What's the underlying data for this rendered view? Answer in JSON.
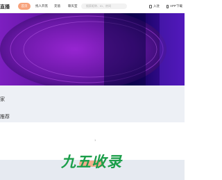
{
  "header": {
    "logo_text": "直播",
    "nav": {
      "home": "首页",
      "find_people": "找人开黑",
      "recharge": "充值",
      "chat_room": "聊天室"
    },
    "search_placeholder": "搜索昵称、ID、房间",
    "login": "入驻",
    "app_download": "APP下载"
  },
  "sections": {
    "first_title": "家",
    "second_title": "推荐",
    "list_count": "1"
  },
  "watermark": "九五收录",
  "colors": {
    "accent": "#f7a27b",
    "banner_purple": "#5a1796",
    "banner_deep": "#12035e",
    "page_bg": "#edf0f5",
    "watermark_green": "#1b9e4a"
  }
}
